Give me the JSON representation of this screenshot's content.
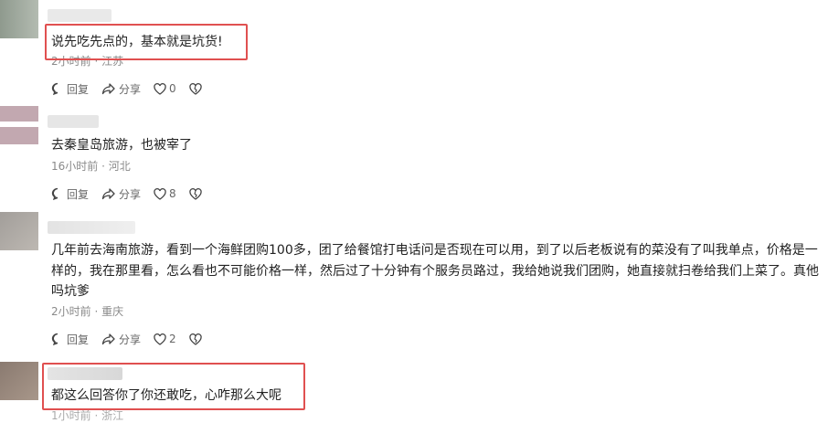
{
  "comments": [
    {
      "text": "说先吃先点的，基本就是坑货!",
      "meta": "2小时前 · 江苏",
      "reply": "回复",
      "share": "分享",
      "likes": "0"
    },
    {
      "text": "去秦皇岛旅游，也被宰了",
      "meta": "16小时前 · 河北",
      "reply": "回复",
      "share": "分享",
      "likes": "8"
    },
    {
      "text_lines": [
        "几年前去海南旅游，看到一个海鲜团购100多，团了给餐馆打电话问是否现在可以用，到了以后老板说有的菜没有了叫我单点，价格是一",
        "样的，我在那里看，怎么看也不可能价格一样，然后过了十分钟有个服务员路过，我给她说我们团购，她直接就扫卷给我们上菜了。真他",
        "吗坑爹"
      ],
      "meta": "2小时前 · 重庆",
      "reply": "回复",
      "share": "分享",
      "likes": "2"
    },
    {
      "text": "都这么回答你了你还敢吃，心咋那么大呢",
      "meta": "1小时前 · 浙江"
    }
  ],
  "icons": {
    "reply": "comment-bubble-icon",
    "share": "share-arrow-icon",
    "like": "heart-icon",
    "dislike": "broken-heart-icon"
  },
  "colors": {
    "highlight": "#e05050",
    "meta": "#8a8a8a",
    "text": "#222222"
  }
}
